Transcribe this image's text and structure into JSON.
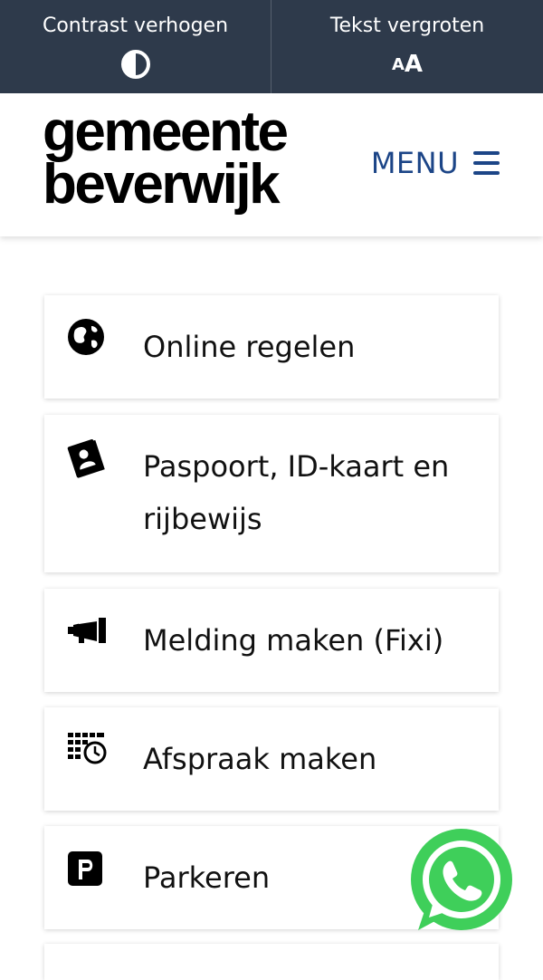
{
  "accessibility_bar": {
    "contrast_label": "Contrast verhogen",
    "contrast_icon": "contrast-icon",
    "textsize_label": "Tekst vergroten",
    "textsize_icon_small": "A",
    "textsize_icon_big": "A"
  },
  "header": {
    "logo_line1": "gemeente",
    "logo_line2": "beverwijk",
    "menu_label": "MENU",
    "menu_icon": "hamburger-icon"
  },
  "tiles": [
    {
      "label": "Online regelen",
      "icon": "globe-icon"
    },
    {
      "label": "Paspoort, ID-kaart en rijbewijs",
      "icon": "passport-icon"
    },
    {
      "label": "Melding maken (Fixi)",
      "icon": "megaphone-icon"
    },
    {
      "label": "Afspraak maken",
      "icon": "calendar-clock-icon"
    },
    {
      "label": "Parkeren",
      "icon": "parking-icon"
    }
  ],
  "floating": {
    "icon": "whatsapp-icon"
  },
  "colors": {
    "topbar_bg": "#2e3a4b",
    "menu_accent": "#1c4587",
    "whatsapp_green": "#3fcf5a"
  }
}
